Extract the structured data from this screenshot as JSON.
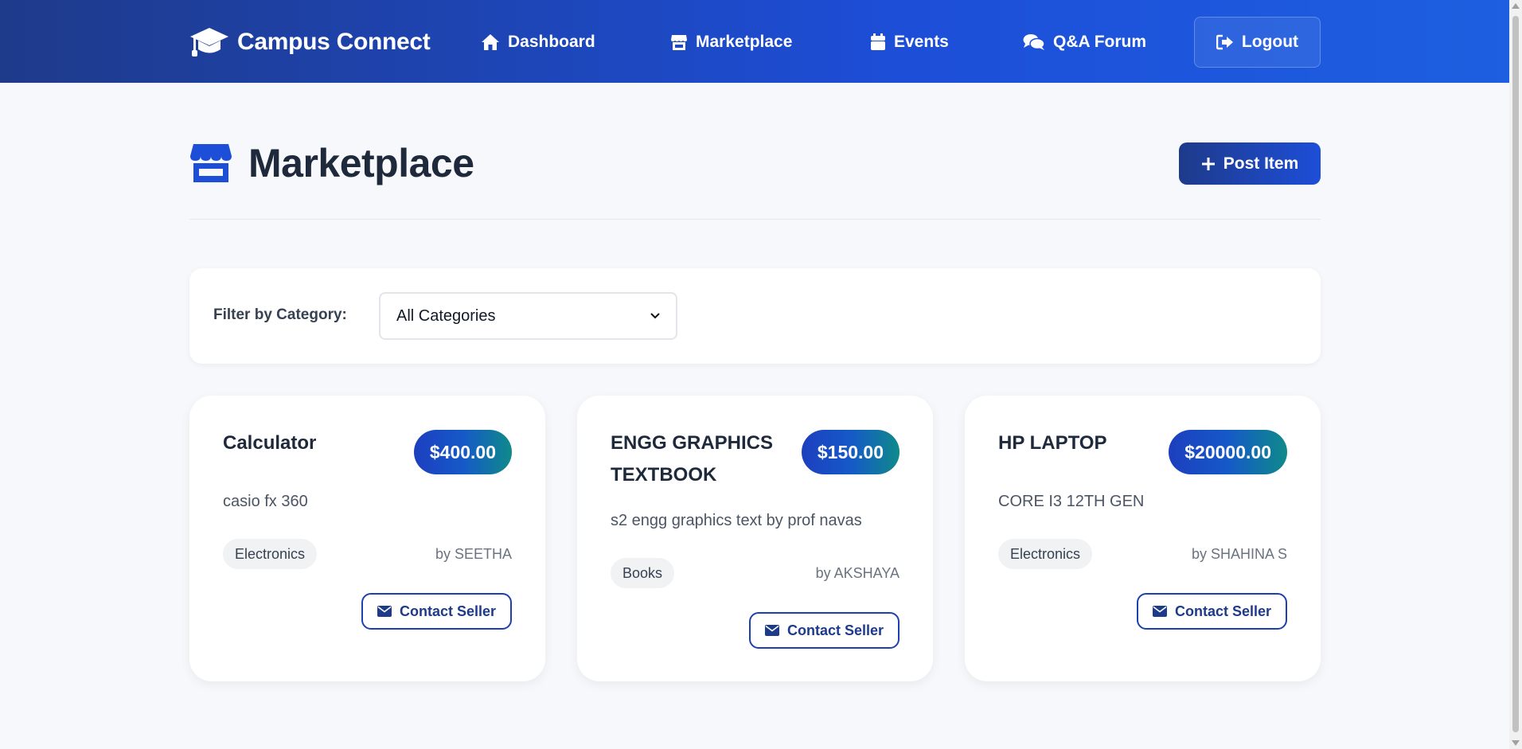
{
  "nav": {
    "brand": "Campus Connect",
    "brand_icon": "graduation-cap-icon",
    "links": [
      {
        "label": "Dashboard",
        "icon": "home-icon"
      },
      {
        "label": "Marketplace",
        "icon": "store-icon"
      },
      {
        "label": "Events",
        "icon": "calendar-icon"
      },
      {
        "label": "Q&A Forum",
        "icon": "comments-icon"
      }
    ],
    "logout": "Logout",
    "logout_icon": "sign-out-icon"
  },
  "page": {
    "title": "Marketplace",
    "title_icon": "store-icon",
    "post_button": "Post Item",
    "post_icon": "plus-icon"
  },
  "filter": {
    "label": "Filter by Category:",
    "selected": "All Categories"
  },
  "items": [
    {
      "title": "Calculator",
      "price": "$400.00",
      "description": "casio fx 360",
      "category": "Electronics",
      "seller": "by SEETHA",
      "contact": "Contact Seller"
    },
    {
      "title": "ENGG GRAPHICS TEXTBOOK",
      "price": "$150.00",
      "description": "s2 engg graphics text by prof navas",
      "category": "Books",
      "seller": "by AKSHAYA",
      "contact": "Contact Seller"
    },
    {
      "title": "HP LAPTOP",
      "price": "$20000.00",
      "description": "CORE I3 12TH GEN",
      "category": "Electronics",
      "seller": "by SHAHINA S",
      "contact": "Contact Seller"
    }
  ],
  "colors": {
    "nav_start": "#1e3a8a",
    "nav_end": "#1d5fe0",
    "accent": "#1d4ed8",
    "price_gradient_end": "#0f8a8a",
    "background": "#f7f8fb"
  }
}
